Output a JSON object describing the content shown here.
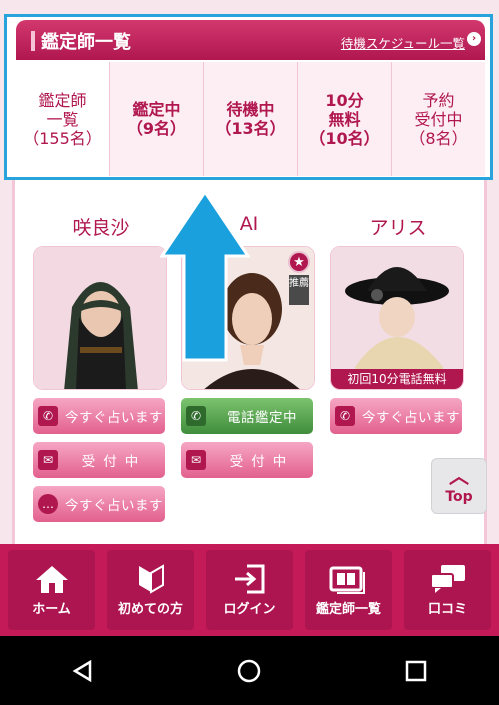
{
  "header": {
    "title": "鑑定師一覧",
    "schedule_link": "待機スケジュール一覧"
  },
  "tabs": [
    {
      "lines": [
        "鑑定師",
        "一覧",
        "（155名）"
      ],
      "active": true
    },
    {
      "lines": [
        "鑑定中",
        "（9名）"
      ],
      "active": false
    },
    {
      "lines": [
        "待機中",
        "（13名）"
      ],
      "active": false
    },
    {
      "lines": [
        "10分",
        "無料",
        "（10名）"
      ],
      "active": false
    },
    {
      "lines": [
        "予約",
        "受付中",
        "（8名）"
      ],
      "active": false
    }
  ],
  "tellers": [
    {
      "name": "咲良沙",
      "buttons": [
        "今すぐ占います",
        "受付中",
        "今すぐ占います"
      ]
    },
    {
      "name": "AI",
      "badge": "推薦",
      "buttons": [
        "電話鑑定中",
        "受付中"
      ]
    },
    {
      "name": "アリス",
      "ribbon": "初回10分電話無料",
      "buttons": [
        "今すぐ占います"
      ]
    }
  ],
  "top_button": "Top",
  "bottom_nav": [
    {
      "label": "ホーム",
      "icon": "home-icon"
    },
    {
      "label": "初めての方",
      "icon": "beginner-mark-icon"
    },
    {
      "label": "ログイン",
      "icon": "login-icon"
    },
    {
      "label": "鑑定師一覧",
      "icon": "album-icon"
    },
    {
      "label": "口コミ",
      "icon": "chat-icon"
    }
  ],
  "colors": {
    "brand": "#c41a58",
    "highlight": "#29a3dc"
  }
}
